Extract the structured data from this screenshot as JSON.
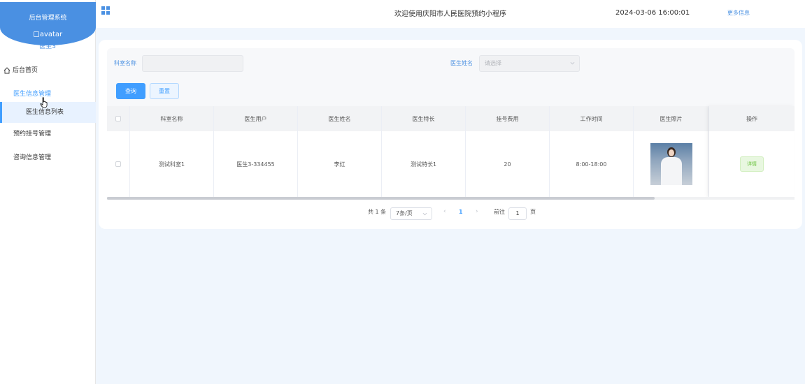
{
  "sidebar": {
    "title": "后台管理系统",
    "avatar_alt": "avatar",
    "user_name": "医生3",
    "menu": {
      "home": "后台首页",
      "doctor_manage": "医生信息管理",
      "doctor_list": "医生信息列表",
      "booking_manage": "预约挂号管理",
      "consult_manage": "咨询信息管理"
    }
  },
  "header": {
    "title": "欢迎使用庆阳市人民医院预约小程序",
    "datetime": "2024-03-06 16:00:01",
    "more": "更多信息"
  },
  "search": {
    "dept_label": "科室名称",
    "dept_value": "",
    "doctor_label": "医生姓名",
    "doctor_placeholder": "请选择",
    "query_button": "查询",
    "reset_button": "重置"
  },
  "table": {
    "columns": [
      "科室名称",
      "医生用户",
      "医生姓名",
      "医生特长",
      "挂号费用",
      "工作时间",
      "医生照片",
      "操作"
    ],
    "rows": [
      {
        "dept": "测试科室1",
        "user": "医生3-334455",
        "name": "李红",
        "specialty": "测试特长1",
        "fee": "20",
        "hours": "8:00-18:00",
        "action": "详情"
      }
    ]
  },
  "pagination": {
    "total": "共 1 条",
    "page_size": "7条/页",
    "current": "1",
    "goto_label": "前往",
    "goto_value": "1",
    "page_suffix": "页"
  },
  "colors": {
    "primary": "#409eff",
    "brand": "#4a90e2",
    "background": "#f0f6fd"
  }
}
